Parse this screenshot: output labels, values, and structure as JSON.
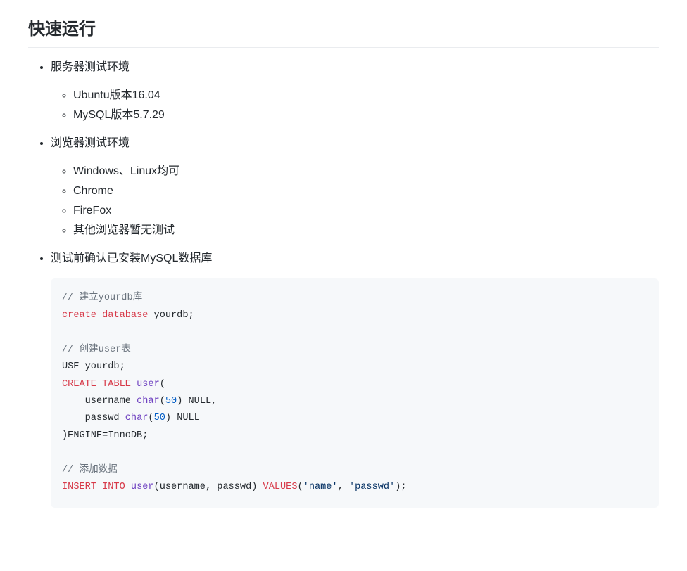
{
  "heading": "快速运行",
  "sections": {
    "server": {
      "title": "服务器测试环境",
      "items": [
        "Ubuntu版本16.04",
        "MySQL版本5.7.29"
      ]
    },
    "browser": {
      "title": "浏览器测试环境",
      "items": [
        "Windows、Linux均可",
        "Chrome",
        "FireFox",
        "其他浏览器暂无测试"
      ]
    },
    "mysql": {
      "title": "测试前确认已安装MySQL数据库"
    }
  },
  "code": {
    "comment1": "// 建立yourdb库",
    "kw_create1": "create",
    "kw_database": "database",
    "yourdb1": " yourdb;",
    "comment2": "// 创建user表",
    "use_line": "USE yourdb;",
    "kw_create2": "CREATE",
    "kw_table": "TABLE",
    "user_open": "(",
    "fn_user1": "user",
    "indent": "    ",
    "col_username": "username ",
    "fn_char1": "char",
    "lp1": "(",
    "num50a": "50",
    "rp1_null": ") NULL,",
    "col_passwd": "passwd ",
    "fn_char2": "char",
    "lp2": "(",
    "num50b": "50",
    "rp2_null": ") NULL",
    "engine_line": ")ENGINE=InnoDB;",
    "comment3": "// 添加数据",
    "kw_insert": "INSERT INTO",
    "fn_user2": "user",
    "insert_cols": "(username, passwd) ",
    "kw_values": "VALUES",
    "lp3": "(",
    "str_name": "'name'",
    "comma": ", ",
    "str_passwd": "'passwd'",
    "rp3": ");"
  }
}
